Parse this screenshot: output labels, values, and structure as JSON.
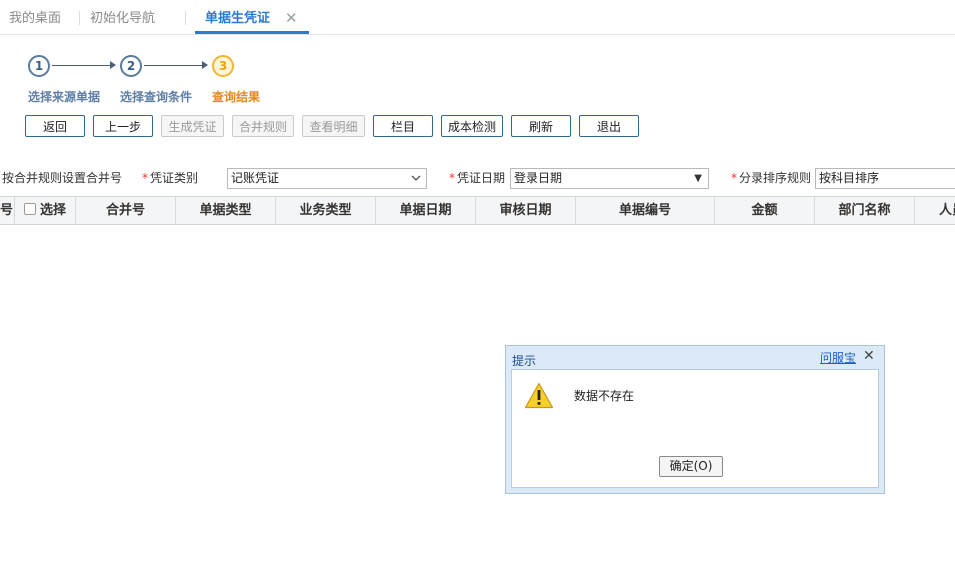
{
  "tabs": [
    {
      "label": "我的桌面"
    },
    {
      "label": "初始化导航"
    },
    {
      "label": "单据生凭证"
    }
  ],
  "tab_close_glyph": "✕",
  "steps": [
    {
      "number": "1",
      "label": "选择来源单据"
    },
    {
      "number": "2",
      "label": "选择查询条件"
    },
    {
      "number": "3",
      "label": "查询结果"
    }
  ],
  "toolbar": {
    "back": "返回",
    "prev": "上一步",
    "generate": "生成凭证",
    "merge_rule": "合并规则",
    "view_detail": "查看明细",
    "columns": "栏目",
    "cost_check": "成本检测",
    "refresh": "刷新",
    "exit": "退出"
  },
  "filters": {
    "merge_by_rule": "按合并规则设置合并号",
    "voucher_type_label": "凭证类别",
    "voucher_type_value": "记账凭证",
    "voucher_date_label": "凭证日期",
    "voucher_date_value": "登录日期",
    "sort_rule_label": "分录排序规则",
    "sort_rule_value": "按科目排序",
    "required_mark": "*"
  },
  "table": {
    "headers": [
      "号",
      "选择",
      "合并号",
      "单据类型",
      "业务类型",
      "单据日期",
      "审核日期",
      "单据编号",
      "金额",
      "部门名称",
      "人员"
    ]
  },
  "dialog": {
    "title": "提示",
    "help_link": "问服宝",
    "close_glyph": "✕",
    "message": "数据不存在",
    "ok_button": "确定(O)"
  },
  "colors": {
    "accent": "#2a7bd2",
    "active_step": "#f2b632",
    "step_label": "#5f7fa6",
    "warning": "#f5c518"
  }
}
